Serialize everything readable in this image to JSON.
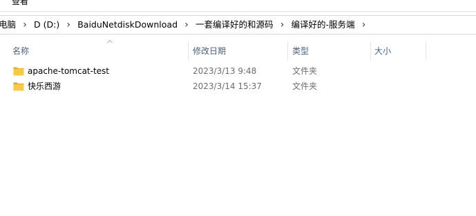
{
  "window": {
    "ribbon_label": "查看"
  },
  "address_bar": {
    "crumbs": [
      "电脑",
      "D (D:)",
      "BaiduNetdiskDownload",
      "一套编译好的和源码",
      "编译好的-服务端"
    ]
  },
  "columns": {
    "name": "名称",
    "modified": "修改日期",
    "type": "类型",
    "size": "大小"
  },
  "files": [
    {
      "name": "apache-tomcat-test",
      "modified": "2023/3/13 9:48",
      "type": "文件夹",
      "icon": "folder-icon"
    },
    {
      "name": "快乐西游",
      "modified": "2023/3/14 15:37",
      "type": "文件夹",
      "icon": "folder-icon"
    }
  ],
  "colors": {
    "folder": "#f7c948",
    "folder_dark": "#e0a92a",
    "header_text": "#4c607a"
  }
}
